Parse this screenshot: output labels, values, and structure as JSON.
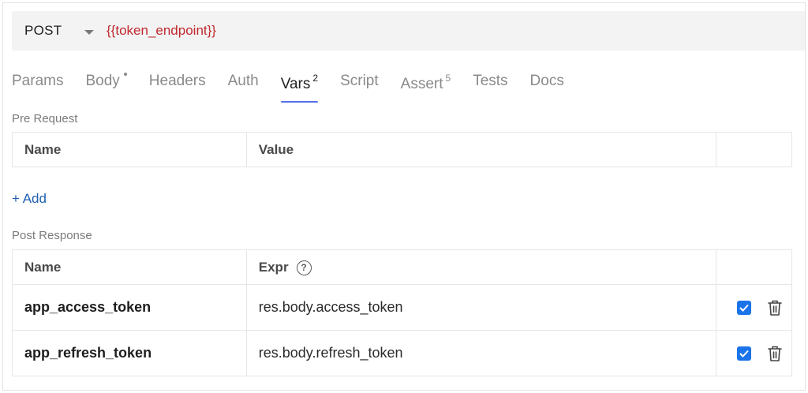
{
  "request": {
    "method": "POST",
    "url": "{{token_endpoint}}"
  },
  "tabs": [
    {
      "label": "Params"
    },
    {
      "label": "Body",
      "dot": true
    },
    {
      "label": "Headers"
    },
    {
      "label": "Auth"
    },
    {
      "label": "Vars",
      "badge": "2",
      "active": true
    },
    {
      "label": "Script"
    },
    {
      "label": "Assert",
      "badge": "5"
    },
    {
      "label": "Tests"
    },
    {
      "label": "Docs"
    }
  ],
  "pre_request": {
    "label": "Pre Request",
    "headers": {
      "name": "Name",
      "value": "Value"
    },
    "add_label": "+ Add"
  },
  "post_response": {
    "label": "Post Response",
    "headers": {
      "name": "Name",
      "expr": "Expr"
    },
    "rows": [
      {
        "name": "app_access_token",
        "expr": "res.body.access_token",
        "enabled": true
      },
      {
        "name": "app_refresh_token",
        "expr": "res.body.refresh_token",
        "enabled": true
      }
    ]
  },
  "colors": {
    "accent": "#5470e6",
    "url": "#c0282d",
    "link": "#1f5fb0",
    "checkbox": "#1a73e8"
  }
}
